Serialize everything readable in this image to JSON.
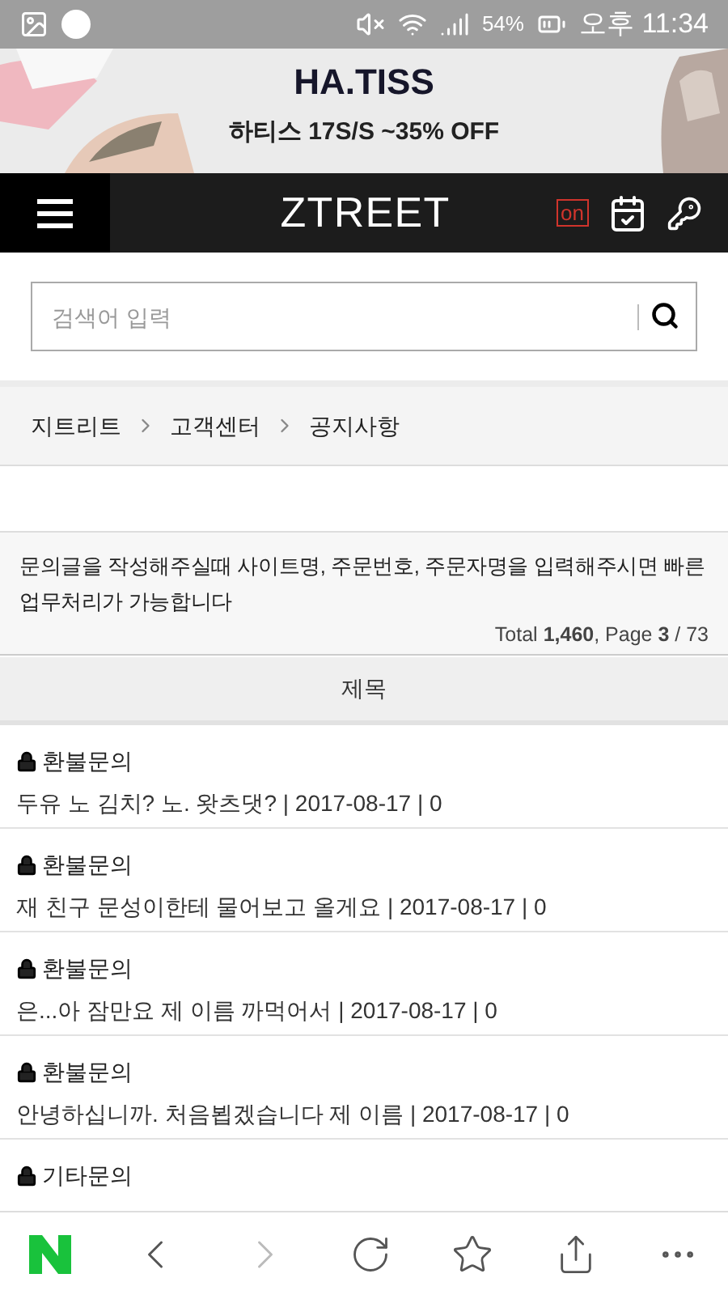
{
  "status_bar": {
    "battery": "54%",
    "time": "오후 11:34"
  },
  "banner": {
    "brand": "HA.TISS",
    "text": "하티스 17S/S ~35% OFF"
  },
  "header": {
    "logo": "ZTREET",
    "badge": "on"
  },
  "search": {
    "placeholder": "검색어 입력"
  },
  "breadcrumb": [
    "지트리트",
    "고객센터",
    "공지사항"
  ],
  "notice": "문의글을 작성해주실때 사이트명, 주문번호, 주문자명을 입력해주시면 빠른 업무처리가 가능합니다",
  "count": "Total **1,460**, Page **3** / 73",
  "table": {
    "column": "제목",
    "rows": [
      {
        "locked": true,
        "category": "환불문의",
        "line": "두유 노 김치? 노. 왓츠댓? | 2017-08-17 | 0"
      },
      {
        "locked": true,
        "category": "환불문의",
        "line": "재 친구 문성이한테 물어보고 올게요 | 2017-08-17 | 0"
      },
      {
        "locked": true,
        "category": "환불문의",
        "line": "은...아 잠만요 제 이름 까먹어서 | 2017-08-17 | 0"
      },
      {
        "locked": true,
        "category": "환불문의",
        "line": "안녕하십니까. 처음뵙겠습니다 제 이름 | 2017-08-17 | 0"
      },
      {
        "locked": true,
        "category": "기타문의"
      }
    ]
  }
}
